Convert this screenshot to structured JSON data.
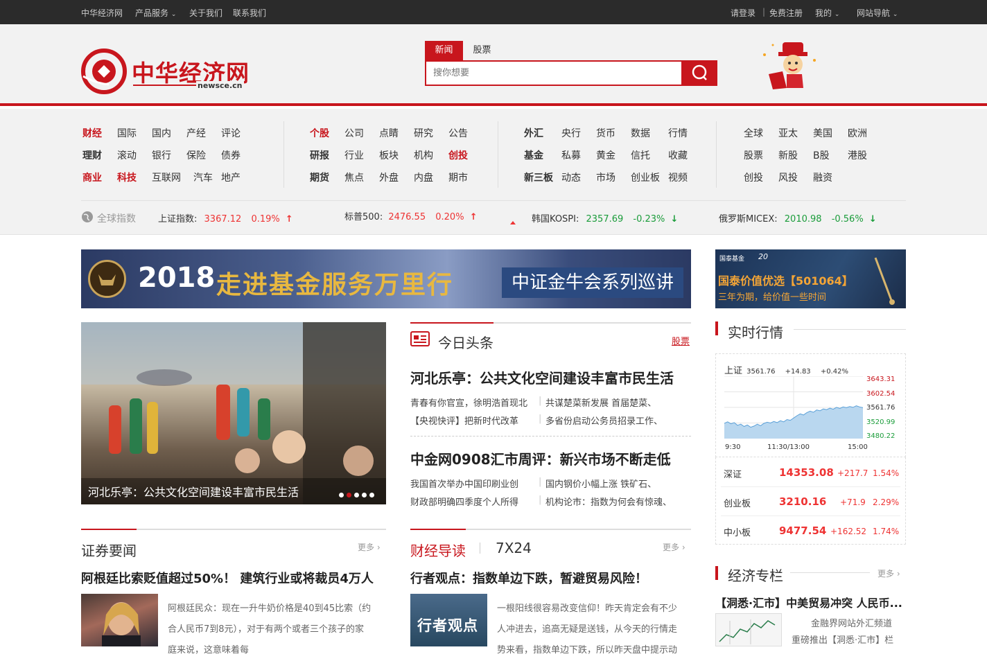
{
  "topbar": {
    "site": "中华经济网",
    "products": "产品服务",
    "about": "关于我们",
    "contact": "联系我们",
    "login": "请登录",
    "sep": "|",
    "register": "免费注册",
    "mine": "我的",
    "sitenav": "网站导航"
  },
  "logo": {
    "cn": "中华经济网",
    "domain": "newsce.cn"
  },
  "search": {
    "tabs": [
      "新闻",
      "股票"
    ],
    "placeholder": "搜你想要"
  },
  "nav": {
    "g1": [
      [
        "财经",
        "国际",
        "国内",
        "产经",
        "评论"
      ],
      [
        "理财",
        "滚动",
        "银行",
        "保险",
        "债券"
      ],
      [
        "商业",
        "科技",
        "互联网",
        "汽车",
        "地产"
      ]
    ],
    "g2": [
      [
        "个股",
        "公司",
        "点睛",
        "研究",
        "公告"
      ],
      [
        "研报",
        "行业",
        "板块",
        "机构",
        "创投"
      ],
      [
        "期货",
        "焦点",
        "外盘",
        "内盘",
        "期市"
      ]
    ],
    "g3": [
      [
        "外汇",
        "央行",
        "货币",
        "数据",
        "行情"
      ],
      [
        "基金",
        "私募",
        "黄金",
        "信托",
        "收藏"
      ],
      [
        "新三板",
        "动态",
        "市场",
        "创业板",
        "视频"
      ]
    ],
    "g4": [
      [
        "全球",
        "亚太",
        "美国",
        "欧洲"
      ],
      [
        "股票",
        "新股",
        "B股",
        "港股"
      ],
      [
        "创投",
        "风投",
        "融资"
      ]
    ]
  },
  "ticker": {
    "label": "全球指数",
    "items": [
      {
        "name": "上证指数:",
        "value": "3367.12",
        "change": "0.19%",
        "dir": "up"
      },
      {
        "name": "标普500:",
        "value": "2476.55",
        "change": "0.20%",
        "dir": "up"
      },
      {
        "name": "韩国KOSPI:",
        "value": "2357.69",
        "change": "-0.23%",
        "dir": "down"
      },
      {
        "name": "俄罗斯MICEX:",
        "value": "2010.98",
        "change": "-0.56%",
        "dir": "down"
      }
    ]
  },
  "banner": {
    "year": "2018",
    "slogan": "走进基金服务万里行",
    "series": "中证金牛会系列巡讲"
  },
  "adright": {
    "brand": "国泰基金",
    "num": "20",
    "title": "国泰价值优选【501064】",
    "sub": "三年为期，给价值一些时间"
  },
  "slider": {
    "caption": "河北乐亭：公共文化空间建设丰富市民生活",
    "dots": 5,
    "active": 1
  },
  "today": {
    "title": "今日头条",
    "tag": "股票",
    "items": [
      {
        "headline": "河北乐亭：公共文化空间建设丰富市民生活",
        "subs": [
          "青春有你官宣，徐明浩首现北",
          "共谋楚菜新发展 首届楚菜、",
          "【央视快评】把新时代改革",
          "多省份启动公务员招录工作、"
        ]
      },
      {
        "headline": "中金网0908汇市周评：新兴市场不断走低",
        "subs": [
          "我国首次举办中国印刷业创",
          "国内钢价小幅上涨 铁矿石、",
          "财政部明确四季度个人所得",
          "机构论市：指数为何会有惊魂、"
        ]
      }
    ]
  },
  "market": {
    "title": "实时行情",
    "chart": {
      "index": "上证",
      "value": "3561.76",
      "change": "+14.83",
      "pct": "+0.42%",
      "levels": [
        "3643.31",
        "3602.54",
        "3561.76",
        "3520.99",
        "3480.22"
      ],
      "times": [
        "9:30",
        "11:30/13:00",
        "15:00"
      ],
      "series": [
        3520,
        3524,
        3519,
        3522,
        3515,
        3518,
        3512,
        3516,
        3510,
        3513,
        3518,
        3514,
        3520,
        3523,
        3521,
        3525,
        3522,
        3527,
        3524,
        3530,
        3528,
        3534,
        3540,
        3545,
        3542,
        3548,
        3552,
        3549,
        3555,
        3553,
        3558,
        3556,
        3560,
        3557,
        3562,
        3559,
        3563,
        3561,
        3564,
        3562,
        3566,
        3563,
        3561
      ]
    },
    "rows": [
      {
        "name": "深证",
        "value": "14353.08",
        "change": "+217.7",
        "pct": "1.54%"
      },
      {
        "name": "创业板",
        "value": "3210.16",
        "change": "+71.9",
        "pct": "2.29%"
      },
      {
        "name": "中小板",
        "value": "9477.54",
        "change": "+162.52",
        "pct": "1.74%"
      }
    ]
  },
  "sec": {
    "title": "证券要闻",
    "more": "更多",
    "headline": "阿根廷比索贬值超过50%！ 建筑行业或将裁员4万人",
    "lines": [
      "阿根廷民众：现在一升牛奶价格是40到45比索（约",
      "合人民币7到8元），对于有两个或者三个孩子的家",
      "庭来说，这意味着每"
    ]
  },
  "fin": {
    "title": "财经导读",
    "tab2": "7X24",
    "more": "更多",
    "headline": "行者观点：指数单边下跌，暂避贸易风险！",
    "thumb": "行者观点",
    "lines": [
      "一根阳线很容易改变信仰！昨天肯定会有不少",
      "人冲进去，追高无疑是送钱，从今天的行情走",
      "势来看，指数单边下跌，所以昨天盘中提示动"
    ]
  },
  "column": {
    "title": "经济专栏",
    "more": "更多",
    "headline": "【洞悉·汇市】中美贸易冲突 人民币...",
    "lines": [
      "金融界网站外汇频道",
      "重磅推出【洞悉·汇市】栏"
    ]
  }
}
